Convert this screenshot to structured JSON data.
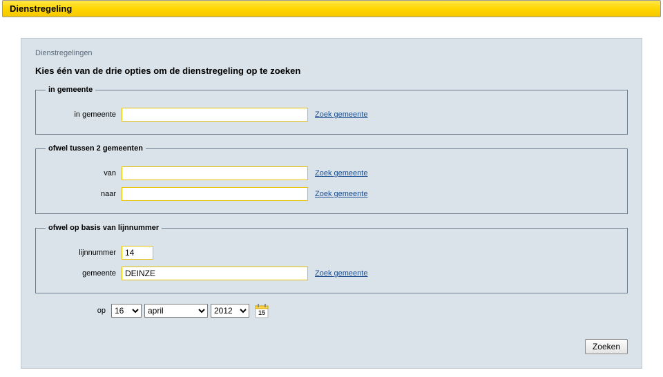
{
  "header": {
    "title": "Dienstregeling"
  },
  "breadcrumb": "Dienstregelingen",
  "instruction": "Kies één van de drie opties om de dienstregeling op te zoeken",
  "group1": {
    "legend": "in gemeente",
    "label_in_gemeente": "in gemeente",
    "value_in_gemeente": "",
    "zoek_link": "Zoek gemeente"
  },
  "group2": {
    "legend": "ofwel tussen 2 gemeenten",
    "label_van": "van",
    "value_van": "",
    "label_naar": "naar",
    "value_naar": "",
    "zoek_link_van": "Zoek gemeente",
    "zoek_link_naar": "Zoek gemeente"
  },
  "group3": {
    "legend": "ofwel op basis van lijnnummer",
    "label_lijnnummer": "lijnnummer",
    "value_lijnnummer": "14",
    "label_gemeente": "gemeente",
    "value_gemeente": "DEINZE",
    "zoek_link": "Zoek gemeente"
  },
  "date": {
    "label": "op",
    "day": "16",
    "month": "april",
    "year": "2012"
  },
  "buttons": {
    "zoeken": "Zoeken"
  }
}
